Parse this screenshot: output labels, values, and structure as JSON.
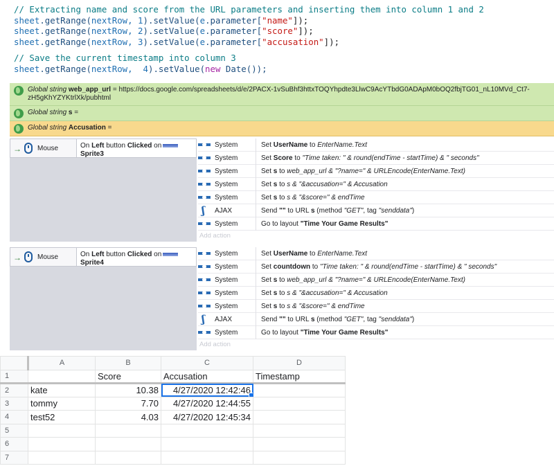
{
  "code": {
    "comment1": "// Extracting name and score from the URL parameters and inserting them into column 1 and 2",
    "lines1": [
      {
        "row": "nextRow, 1",
        "param": "\"name\""
      },
      {
        "row": "nextRow, 2",
        "param": "\"score\""
      },
      {
        "row": "nextRow, 3",
        "param": "\"accusation\""
      }
    ],
    "comment2": "// Save the current timestamp into column 3",
    "line4_row": "nextRow,  4",
    "tokens": {
      "sheet": "sheet",
      "getRange": ".getRange(",
      "setValue": ").setValue(",
      "e": "e",
      "parameter": ".parameter[",
      "close": "]);",
      "new": "new",
      "date": " Date());"
    }
  },
  "globals": [
    {
      "prefix": "Global string ",
      "name": "web_app_url",
      "value": " = https://docs.google.com/spreadsheets/d/e/2PACX-1vSuBhf3httxTOQYhpdte3LlwC9AcYTbdG0ADApM0bOQ2fbjTG01_nL10MVd_Ct7-zH5gKhYZYKtrlXk/pubhtml",
      "color": "#cfe8b0"
    },
    {
      "prefix": "Global string ",
      "name": "s",
      "value": " =",
      "color": "#cfe8b0"
    },
    {
      "prefix": "Global string ",
      "name": "Accusation",
      "value": " =",
      "color": "#f8d98d"
    }
  ],
  "events": [
    {
      "object": "Mouse",
      "cond_pre": "On ",
      "cond_button": "Left",
      "cond_mid": " button ",
      "cond_clicked": "Clicked",
      "cond_on": " on",
      "sprite": "Sprite3",
      "actions": [
        {
          "icon": "gear-icon",
          "obj": "System",
          "parts": [
            [
              "t",
              "Set "
            ],
            [
              "b",
              "UserName"
            ],
            [
              "t",
              " to "
            ],
            [
              "i",
              "EnterName.Text"
            ]
          ]
        },
        {
          "icon": "gear-icon",
          "obj": "System",
          "parts": [
            [
              "t",
              "Set "
            ],
            [
              "b",
              "Score"
            ],
            [
              "t",
              " to "
            ],
            [
              "i",
              "\"Time taken: \" & round(endTime - startTime) & \" seconds\""
            ]
          ]
        },
        {
          "icon": "gear-icon",
          "obj": "System",
          "parts": [
            [
              "t",
              "Set "
            ],
            [
              "b",
              "s"
            ],
            [
              "t",
              " to "
            ],
            [
              "i",
              "web_app_url & \"?name=\" & URLEncode(EnterName.Text)"
            ]
          ]
        },
        {
          "icon": "gear-icon",
          "obj": "System",
          "parts": [
            [
              "t",
              "Set "
            ],
            [
              "b",
              "s"
            ],
            [
              "t",
              " to "
            ],
            [
              "i",
              "s & \"&accusation=\" & Accusation"
            ]
          ]
        },
        {
          "icon": "gear-icon",
          "obj": "System",
          "parts": [
            [
              "t",
              "Set "
            ],
            [
              "b",
              "s"
            ],
            [
              "t",
              " to "
            ],
            [
              "i",
              "s & \"&score=\" & endTime"
            ]
          ]
        },
        {
          "icon": "ajax-icon",
          "obj": "AJAX",
          "parts": [
            [
              "t",
              "Send "
            ],
            [
              "b",
              "\"\""
            ],
            [
              "t",
              " to URL "
            ],
            [
              "b",
              "s"
            ],
            [
              "t",
              " (method "
            ],
            [
              "i",
              "\"GET\""
            ],
            [
              "t",
              ", tag "
            ],
            [
              "i",
              "\"senddata\""
            ],
            [
              "t",
              ")"
            ]
          ]
        },
        {
          "icon": "gear-icon",
          "obj": "System",
          "parts": [
            [
              "t",
              "Go to layout "
            ],
            [
              "b",
              "\"Time Your Game Results\""
            ]
          ]
        }
      ],
      "add_action": "Add action"
    },
    {
      "object": "Mouse",
      "cond_pre": "On ",
      "cond_button": "Left",
      "cond_mid": " button ",
      "cond_clicked": "Clicked",
      "cond_on": " on",
      "sprite": "Sprite4",
      "actions": [
        {
          "icon": "gear-icon",
          "obj": "System",
          "parts": [
            [
              "t",
              "Set "
            ],
            [
              "b",
              "UserName"
            ],
            [
              "t",
              " to "
            ],
            [
              "i",
              "EnterName.Text"
            ]
          ]
        },
        {
          "icon": "gear-icon",
          "obj": "System",
          "parts": [
            [
              "t",
              "Set "
            ],
            [
              "b",
              "countdown"
            ],
            [
              "t",
              " to "
            ],
            [
              "i",
              "\"Time taken: \" & round(endTime - startTime) & \" seconds\""
            ]
          ]
        },
        {
          "icon": "gear-icon",
          "obj": "System",
          "parts": [
            [
              "t",
              "Set "
            ],
            [
              "b",
              "s"
            ],
            [
              "t",
              " to "
            ],
            [
              "i",
              "web_app_url & \"?name=\" & URLEncode(EnterName.Text)"
            ]
          ]
        },
        {
          "icon": "gear-icon",
          "obj": "System",
          "parts": [
            [
              "t",
              "Set "
            ],
            [
              "b",
              "s"
            ],
            [
              "t",
              " to "
            ],
            [
              "i",
              "s & \"&accusation=\" & Accusation"
            ]
          ]
        },
        {
          "icon": "gear-icon",
          "obj": "System",
          "parts": [
            [
              "t",
              "Set "
            ],
            [
              "b",
              "s"
            ],
            [
              "t",
              " to "
            ],
            [
              "i",
              "s & \"&score=\" & endTime"
            ]
          ]
        },
        {
          "icon": "ajax-icon",
          "obj": "AJAX",
          "parts": [
            [
              "t",
              "Send "
            ],
            [
              "b",
              "\"\""
            ],
            [
              "t",
              " to URL "
            ],
            [
              "b",
              "s"
            ],
            [
              "t",
              " (method "
            ],
            [
              "i",
              "\"GET\""
            ],
            [
              "t",
              ", tag "
            ],
            [
              "i",
              "\"senddata\""
            ],
            [
              "t",
              ")"
            ]
          ]
        },
        {
          "icon": "gear-icon",
          "obj": "System",
          "parts": [
            [
              "t",
              "Go to layout "
            ],
            [
              "b",
              "\"Time Your Game Results\""
            ]
          ]
        }
      ],
      "add_action": "Add action"
    }
  ],
  "spreadsheet": {
    "columns": [
      "A",
      "B",
      "C",
      "D"
    ],
    "rows": [
      {
        "n": "1",
        "cells": [
          "",
          "Score",
          "Accusation",
          "Timestamp"
        ]
      },
      {
        "n": "2",
        "cells": [
          "kate",
          "10.38",
          "4/27/2020 12:42:46",
          ""
        ]
      },
      {
        "n": "3",
        "cells": [
          "tommy",
          "7.70",
          "4/27/2020 12:44:55",
          ""
        ]
      },
      {
        "n": "4",
        "cells": [
          "test52",
          "4.03",
          "4/27/2020 12:45:34",
          ""
        ]
      },
      {
        "n": "5",
        "cells": [
          "",
          "",
          "",
          ""
        ]
      },
      {
        "n": "6",
        "cells": [
          "",
          "",
          "",
          ""
        ]
      },
      {
        "n": "7",
        "cells": [
          "",
          "",
          "",
          ""
        ]
      }
    ],
    "selected_cell": "C2"
  }
}
